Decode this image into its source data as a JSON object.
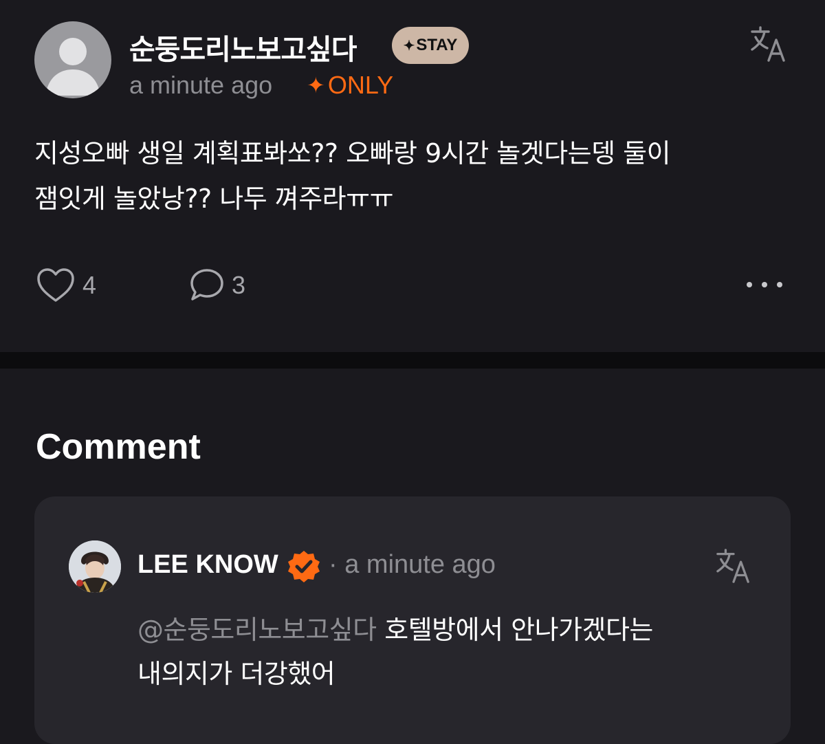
{
  "post": {
    "author": "순둥도리노보고싶다",
    "badge_label": "STAY",
    "badge_icon": "sparkle-icon",
    "time": "a minute ago",
    "only_label": "ONLY",
    "only_color": "#ff6a13",
    "body_line1": "지성오빠 생일 계획표봐쏘?? 오빠랑 9시간 놀겟다는뎅 둘이",
    "body_line2": "잼잇게 놀았낭?? 나두 껴주라ㅠㅠ",
    "like_count": "4",
    "comment_count": "3",
    "icons": [
      "translate-icon",
      "heart-icon",
      "comment-bubble-icon",
      "more-dots-icon"
    ]
  },
  "comments_section": {
    "heading": "Comment",
    "items": [
      {
        "author": "LEE KNOW",
        "separator": "·",
        "time": "a minute ago",
        "mention": "@순둥도리노보고싶다",
        "text_line1": "호텔방에서 안나가겠다는",
        "text_line2": "내의지가 더강했어",
        "verified_color": "#ff6a13"
      }
    ]
  },
  "colors": {
    "background": "#1a191e",
    "card": "#27262c",
    "badge": "#cdb7a6",
    "muted_text": "#8e8e93"
  }
}
